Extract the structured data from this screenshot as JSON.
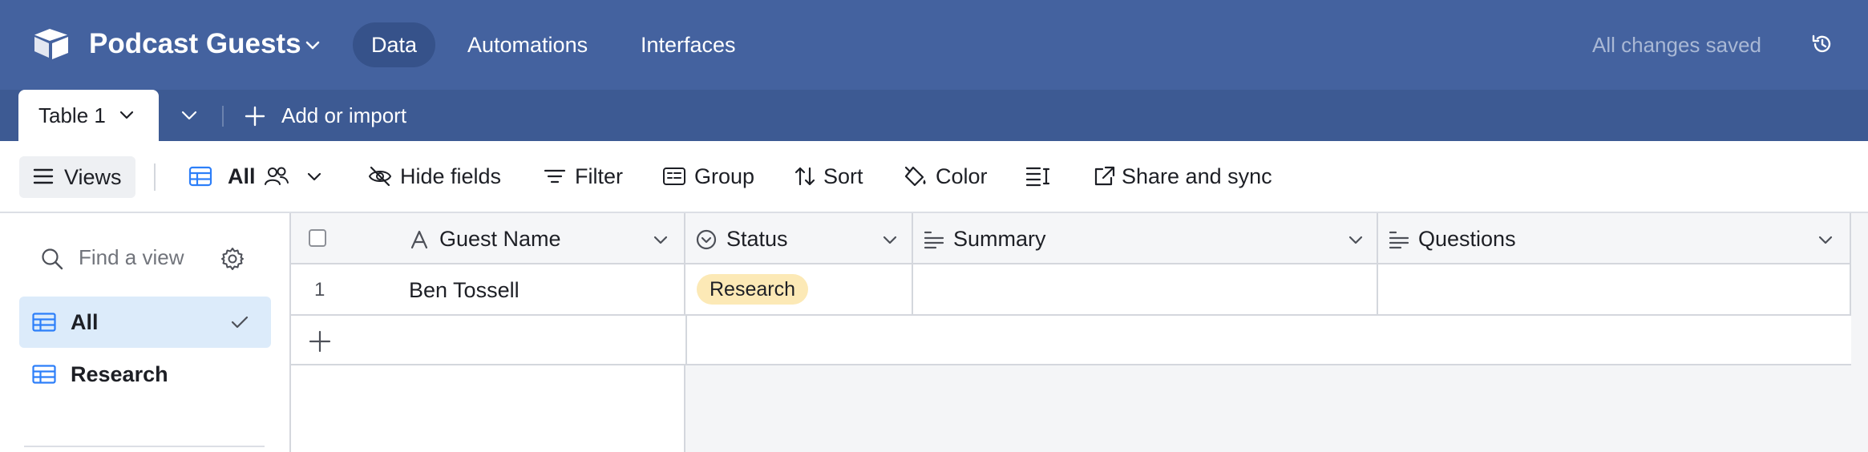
{
  "app": {
    "base_name": "Podcast Guests",
    "nav_tabs": [
      "Data",
      "Automations",
      "Interfaces"
    ],
    "active_nav": "Data",
    "save_status": "All changes saved",
    "brand_color": "#44629f"
  },
  "tabbar": {
    "table_tab": "Table 1",
    "add_import": "Add or import"
  },
  "toolbar": {
    "views": "Views",
    "current_view": "All",
    "hide_fields": "Hide fields",
    "filter": "Filter",
    "group": "Group",
    "sort": "Sort",
    "color": "Color",
    "share_sync": "Share and sync"
  },
  "sidebar": {
    "search_placeholder": "Find a view",
    "views": [
      {
        "label": "All",
        "selected": true
      },
      {
        "label": "Research",
        "selected": false
      }
    ]
  },
  "grid": {
    "columns": [
      {
        "label": "Guest Name",
        "icon": "text-field-icon"
      },
      {
        "label": "Status",
        "icon": "single-select-icon"
      },
      {
        "label": "Summary",
        "icon": "long-text-icon"
      },
      {
        "label": "Questions",
        "icon": "long-text-icon"
      }
    ],
    "rows": [
      {
        "number": "1",
        "guest_name": "Ben Tossell",
        "status": "Research",
        "summary": "",
        "questions": ""
      }
    ],
    "status_color": "#fce9b6"
  }
}
